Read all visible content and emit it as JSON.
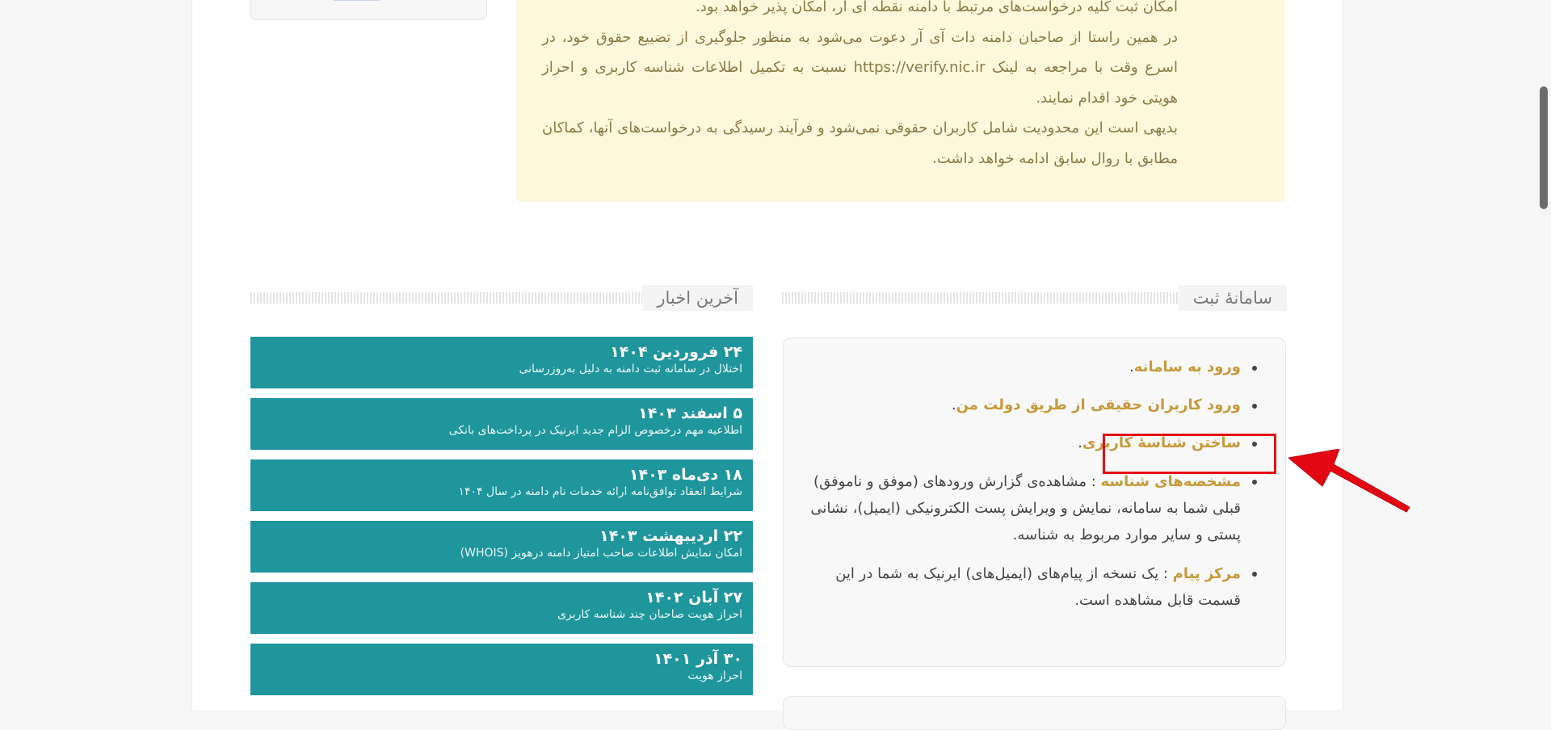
{
  "notice": {
    "paragraphs": [
      "امکان ثبت کلیه درخواست‌های مرتبط با دامنه نقطه آی آر، امکان پذیر خواهد بود.",
      "در همین راستا از صاحبان دامنه دات آی آر دعوت می‌شود به منظور جلوگیری از تضییع حقوق خود، در اسرع وقت با مراجعه به لینک https://verify.nic.ir نسبت به تکمیل اطلاعات شناسه کاربری و احراز هویتی خود اقدام نمایند.",
      "بدیهی است این محدودیت شامل کاربران حقوقی نمی‌شود و فرآیند رسیدگی به درخواست‌های آنها، کماکان مطابق با روال سابق ادامه خواهد داشت."
    ]
  },
  "register_section": {
    "title": "سامانهٔ ثبت",
    "items": [
      {
        "link": "ورود به سامانه",
        "suffix": "."
      },
      {
        "link": "ورود کاربران حقیقی از طریق دولت من",
        "suffix": "."
      },
      {
        "link": "ساختن شناسهٔ کاربری",
        "suffix": "."
      },
      {
        "link": "مشخصه‌های شناسه",
        "text": " : مشاهده‌ی گزارش ورودهای (موفق و ناموفق) قبلی شما به سامانه، نمایش و ویرایش پست الکترونیکی (ایمیل)، نشانی پستی و سایر موارد مربوط به شناسه."
      },
      {
        "link": "مرکز پیام",
        "text": " : یک نسخه از پیام‌های (ایمیل‌های) ایرنیک به شما در این قسمت قابل مشاهده است."
      }
    ]
  },
  "news_section": {
    "title": "آخرین اخبار",
    "items": [
      {
        "date": "۲۴ فروردین ۱۴۰۴",
        "title": "اختلال در سامانه ثبت دامنه به دلیل به‌روزرسانی"
      },
      {
        "date": "۵ اسفند ۱۴۰۳",
        "title": "اطلاعیه مهم درخصوص الزام جدید ایرنیک در پرداخت‌های بانکی"
      },
      {
        "date": "۱۸ دی‌ماه ۱۴۰۳",
        "title": "شرایط انعقاد توافق‌نامه ارائه خدمات نام دامنه در سال ۱۴۰۴"
      },
      {
        "date": "۲۲ اردیبهشت ۱۴۰۳",
        "title": "امکان نمایش اطلاعات صاحب امتیاز دامنه درهویز (WHOIS)"
      },
      {
        "date": "۲۷ آبان ۱۴۰۲",
        "title": "احراز هویت صاحبان چند شناسه کاربری"
      },
      {
        "date": "۳۰ آذر ۱۴۰۱",
        "title": "احراز هویت"
      }
    ]
  },
  "colors": {
    "link": "#c79a3a",
    "news_bg": "#1f959c",
    "notice_bg": "#fdf7dc",
    "highlight": "#e30613"
  }
}
